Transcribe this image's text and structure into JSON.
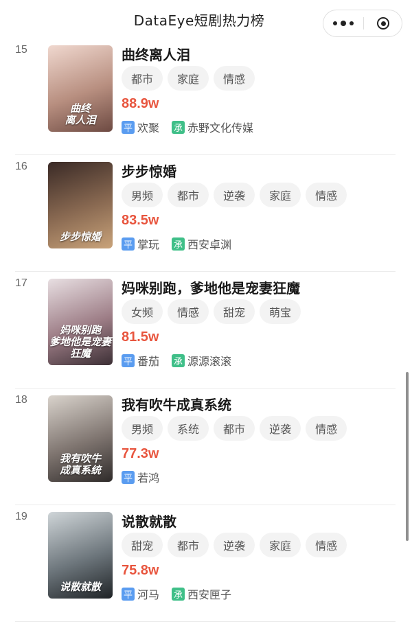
{
  "header": {
    "title": "DataEye短剧热力榜"
  },
  "list": [
    {
      "rank": "15",
      "name": "曲终离人泪",
      "tags": [
        "都市",
        "家庭",
        "情感"
      ],
      "heat": "88.9w",
      "platform_badge": "平",
      "platform": "欢聚",
      "producer_badge": "承",
      "producer": "赤野文化传媒",
      "poster_text": "曲终\n离人泪",
      "poster_colors": [
        "#f0d8cf",
        "#b88f80",
        "#6d4a42"
      ]
    },
    {
      "rank": "16",
      "name": "步步惊婚",
      "tags": [
        "男频",
        "都市",
        "逆袭",
        "家庭",
        "情感"
      ],
      "heat": "83.5w",
      "platform_badge": "平",
      "platform": "掌玩",
      "producer_badge": "承",
      "producer": "西安卓渊",
      "poster_text": "步步惊婚",
      "poster_colors": [
        "#3a2a26",
        "#8a6a52",
        "#c9a37a"
      ]
    },
    {
      "rank": "17",
      "name": "妈咪别跑，爹地他是宠妻狂魔",
      "tags": [
        "女频",
        "情感",
        "甜宠",
        "萌宝"
      ],
      "heat": "81.5w",
      "platform_badge": "平",
      "platform": "番茄",
      "producer_badge": "承",
      "producer": "源源滚滚",
      "poster_text": "妈咪别跑\n爹地他是宠妻狂魔",
      "poster_colors": [
        "#e8dfe2",
        "#9d7d86",
        "#3c2f35"
      ]
    },
    {
      "rank": "18",
      "name": "我有吹牛成真系统",
      "tags": [
        "男频",
        "系统",
        "都市",
        "逆袭",
        "情感"
      ],
      "heat": "77.3w",
      "platform_badge": "平",
      "platform": "若鸿",
      "producer_badge": "",
      "producer": "",
      "poster_text": "我有吹牛\n成真系统",
      "poster_colors": [
        "#d9d3cc",
        "#7f7570",
        "#2f2b2a"
      ]
    },
    {
      "rank": "19",
      "name": "说散就散",
      "tags": [
        "甜宠",
        "都市",
        "逆袭",
        "家庭",
        "情感"
      ],
      "heat": "75.8w",
      "platform_badge": "平",
      "platform": "河马",
      "producer_badge": "承",
      "producer": "西安匣子",
      "poster_text": "说散就散",
      "poster_colors": [
        "#cfd5d8",
        "#6d767c",
        "#1f2326"
      ]
    }
  ],
  "colors": {
    "heat": "#e8553e",
    "platform_badge": "#5a9cf0",
    "producer_badge": "#3fbf88",
    "tag_bg": "#f3f3f3"
  }
}
